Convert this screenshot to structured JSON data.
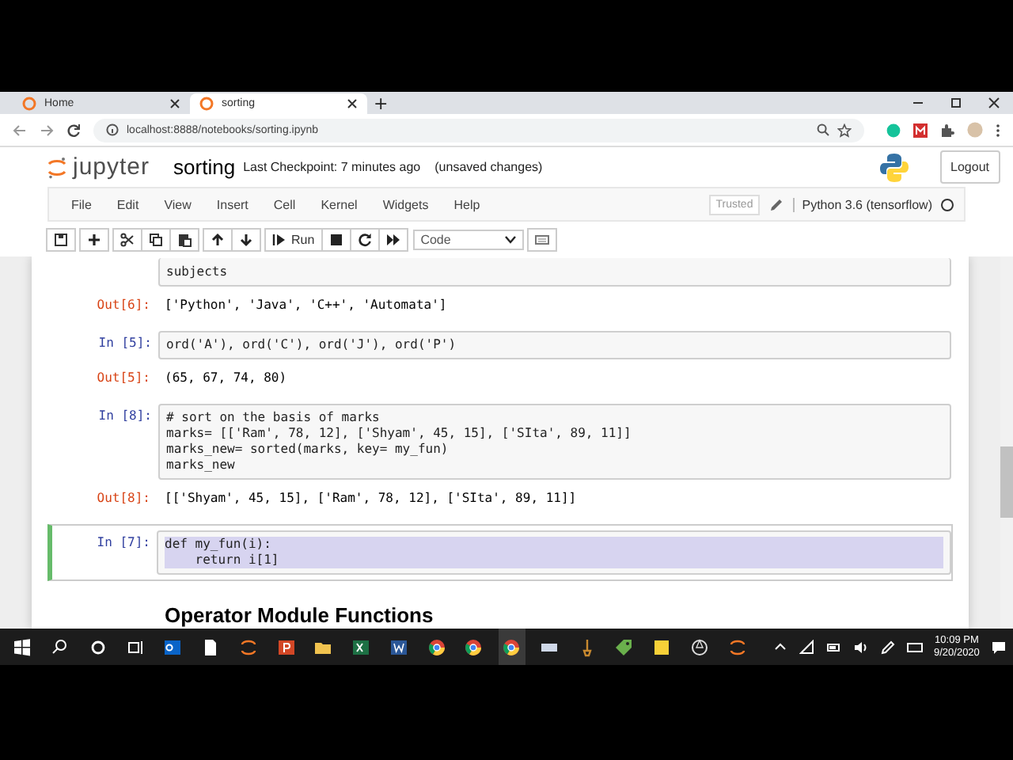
{
  "browser": {
    "tabs": [
      {
        "title": "Home",
        "selected": false
      },
      {
        "title": "sorting",
        "selected": true
      }
    ],
    "new_tab": "+",
    "url": "localhost:8888/notebooks/sorting.ipynb"
  },
  "header": {
    "logo_text": "jupyter",
    "notebook_name": "sorting",
    "checkpoint": "Last Checkpoint: 7 minutes ago",
    "unsaved": "(unsaved changes)",
    "logout": "Logout"
  },
  "menu": {
    "items": [
      "File",
      "Edit",
      "View",
      "Insert",
      "Cell",
      "Kernel",
      "Widgets",
      "Help"
    ],
    "trusted": "Trusted",
    "kernel": "Python 3.6 (tensorflow)"
  },
  "toolbar": {
    "run": "Run",
    "cell_type": "Code"
  },
  "cells": [
    {
      "kind": "code",
      "lines": [
        "subjects"
      ],
      "selected": false,
      "output_prompt": "Out[6]:",
      "output": "['Python', 'Java', 'C++', 'Automata']"
    },
    {
      "kind": "code",
      "prompt": "In [5]:",
      "lines": [
        "ord('A'), ord('C'), ord('J'), ord('P')"
      ],
      "selected": false,
      "output_prompt": "Out[5]:",
      "output": "(65, 67, 74, 80)"
    },
    {
      "kind": "code",
      "prompt": "In [8]:",
      "lines": [
        "# sort on the basis of marks",
        "marks= [['Ram', 78, 12], ['Shyam', 45, 15], ['SIta', 89, 11]]",
        "marks_new= sorted(marks, key= my_fun)",
        "marks_new"
      ],
      "selected": false,
      "output_prompt": "Out[8]:",
      "output": "[['Shyam', 45, 15], ['Ram', 78, 12], ['SIta', 89, 11]]"
    },
    {
      "kind": "code",
      "prompt": "In [7]:",
      "lines": [
        "def my_fun(i):",
        "    return i[1]"
      ],
      "selected": true
    },
    {
      "kind": "heading",
      "text": "Operator Module Functions"
    }
  ],
  "taskbar": {
    "time": "10:09 PM",
    "date": "9/20/2020"
  }
}
